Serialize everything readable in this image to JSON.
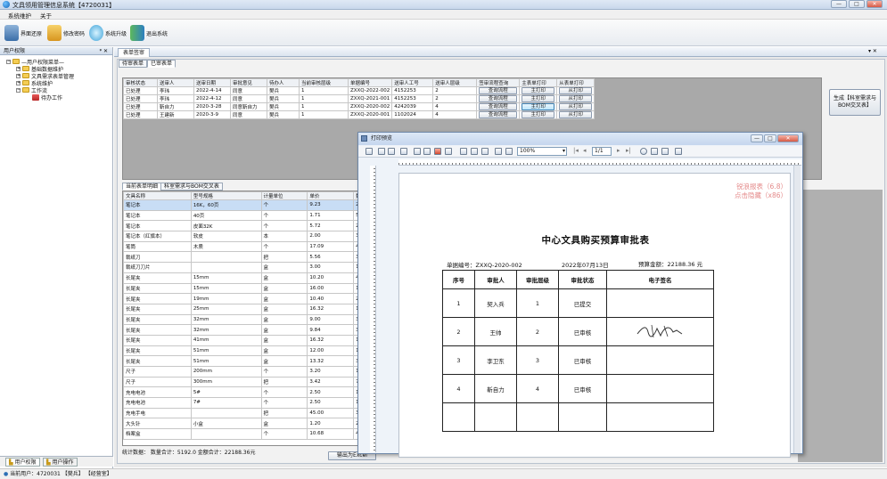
{
  "window": {
    "title": "文具领用管理信息系统【4720031】",
    "controls": [
      "—",
      "□",
      "✕"
    ]
  },
  "menu": [
    "系统维护",
    "关于"
  ],
  "toolbar": [
    {
      "label": "界面还原",
      "icon": "reset-layout-icon"
    },
    {
      "label": "修改密码",
      "icon": "password-icon"
    },
    {
      "label": "系统升级",
      "icon": "upgrade-icon"
    },
    {
      "label": "退出系统",
      "icon": "exit-icon"
    }
  ],
  "left_panel": {
    "title": "用户权限",
    "pin": "ᵠ ✕",
    "tree": [
      {
        "label": "—用户权限菜单—",
        "level": 0
      },
      {
        "label": "基础数据维护",
        "level": 1
      },
      {
        "label": "文具需求表单管理",
        "level": 1
      },
      {
        "label": "系统维护",
        "level": 1
      },
      {
        "label": "工作流",
        "level": 1
      },
      {
        "label": "待办工作",
        "level": 2
      }
    ],
    "tabs": [
      "用户权限",
      "用户操作"
    ]
  },
  "doc": {
    "tab": "表单签审",
    "close": "▾ ✕",
    "subtabs": [
      "待审表单",
      "已审表单"
    ],
    "side_button": "生成【科室需求与BOM交叉表】"
  },
  "approval_grid": {
    "headers": [
      "审核状态",
      "送审人",
      "送审日期",
      "审批意见",
      "待办人",
      "当前审核层级",
      "单据编号",
      "送审人工号",
      "送审人层级",
      "签审流程查询",
      "主表单打印",
      "从表单打印"
    ],
    "rows": [
      [
        "已处理",
        "李玮",
        "2022-4-14",
        "同意",
        "樊兵",
        "1",
        "ZXXQ-2022-002",
        "4152253",
        "2",
        "查询流程",
        "主打印",
        "从打印"
      ],
      [
        "已处理",
        "李玮",
        "2022-4-12",
        "同意",
        "樊兵",
        "1",
        "ZXXQ-2021-001",
        "4152253",
        "2",
        "查询流程",
        "主打印",
        "从打印"
      ],
      [
        "已处理",
        "靳自力",
        "2020-3-28",
        "同意靳自力",
        "樊兵",
        "1",
        "ZXXQ-2020-002",
        "4242039",
        "4",
        "查询流程",
        "主打印",
        "从打印"
      ],
      [
        "已处理",
        "王建新",
        "2020-3-9",
        "同意",
        "樊兵",
        "1",
        "ZXXQ-2020-001",
        "1102024",
        "4",
        "查询流程",
        "主打印",
        "从打印"
      ]
    ]
  },
  "detail_tabs": [
    "当前表单明细",
    "科室需求与BOM交叉表"
  ],
  "detail_grid": {
    "headers": [
      "文具名称",
      "型号规格",
      "计量单位",
      "单价",
      "数"
    ],
    "rows": [
      [
        "笔记本",
        "16K，60页",
        "个",
        "9.23",
        "2"
      ],
      [
        "笔记本",
        "40页",
        "个",
        "1.71",
        "5"
      ],
      [
        "笔记本",
        "皮面32K",
        "个",
        "5.72",
        "2"
      ],
      [
        "笔记本（红旗本）",
        "软皮",
        "本",
        "2.00",
        "3"
      ],
      [
        "笔筒",
        "木质",
        "个",
        "17.09",
        "4"
      ],
      [
        "裁纸刀",
        "",
        "把",
        "5.56",
        "3"
      ],
      [
        "裁纸刀刀片",
        "",
        "盒",
        "3.00",
        "1"
      ],
      [
        "长尾夹",
        "15mm",
        "盒",
        "10.20",
        "4"
      ],
      [
        "长尾夹",
        "15mm",
        "盒",
        "16.00",
        "1"
      ],
      [
        "长尾夹",
        "19mm",
        "盒",
        "10.40",
        "2"
      ],
      [
        "长尾夹",
        "25mm",
        "盒",
        "16.32",
        "1"
      ],
      [
        "长尾夹",
        "32mm",
        "盒",
        "9.00",
        "3"
      ],
      [
        "长尾夹",
        "32mm",
        "盒",
        "9.84",
        "3"
      ],
      [
        "长尾夹",
        "41mm",
        "盒",
        "16.32",
        "1"
      ],
      [
        "长尾夹",
        "51mm",
        "盒",
        "12.00",
        "1"
      ],
      [
        "长尾夹",
        "51mm",
        "盒",
        "13.32",
        "3"
      ],
      [
        "尺子",
        "200mm",
        "个",
        "3.20",
        "1"
      ],
      [
        "尺子",
        "300mm",
        "把",
        "3.42",
        "7"
      ],
      [
        "充电电池",
        "5#",
        "个",
        "2.50",
        "1"
      ],
      [
        "充电电池",
        "7#",
        "个",
        "2.50",
        "1"
      ],
      [
        "充电手电",
        "",
        "把",
        "45.00",
        "3"
      ],
      [
        "大头针",
        "小盒",
        "盒",
        "1.20",
        "2"
      ],
      [
        "档案盒",
        "",
        "个",
        "10.68",
        "4"
      ]
    ]
  },
  "summary": "统计数据：  数量合计：5192.0   金额合计：22188.36元",
  "export_button": "输出为Excel",
  "preview": {
    "title": "打印预览",
    "zoom": "100%",
    "page": "1/1",
    "watermark": [
      "锐浪报表（6.8）",
      "点击隐藏（x86）"
    ],
    "doc_title": "中心文具购买预算审批表",
    "doc_no": "单据编号：ZXXQ-2020-002",
    "date": "2022年07月13日",
    "budget": "预算金额：22188.36 元",
    "headers": [
      "序号",
      "审批人",
      "审批层级",
      "审批状态",
      "电子签名"
    ],
    "rows": [
      [
        "1",
        "契入兵",
        "1",
        "已提交",
        ""
      ],
      [
        "2",
        "王帅",
        "2",
        "已审核",
        "签名"
      ],
      [
        "3",
        "李卫东",
        "3",
        "已审核",
        ""
      ],
      [
        "4",
        "靳自力",
        "4",
        "已审核",
        ""
      ]
    ]
  },
  "status": "当前用户：4720031 【樊兵】 【经营室】"
}
